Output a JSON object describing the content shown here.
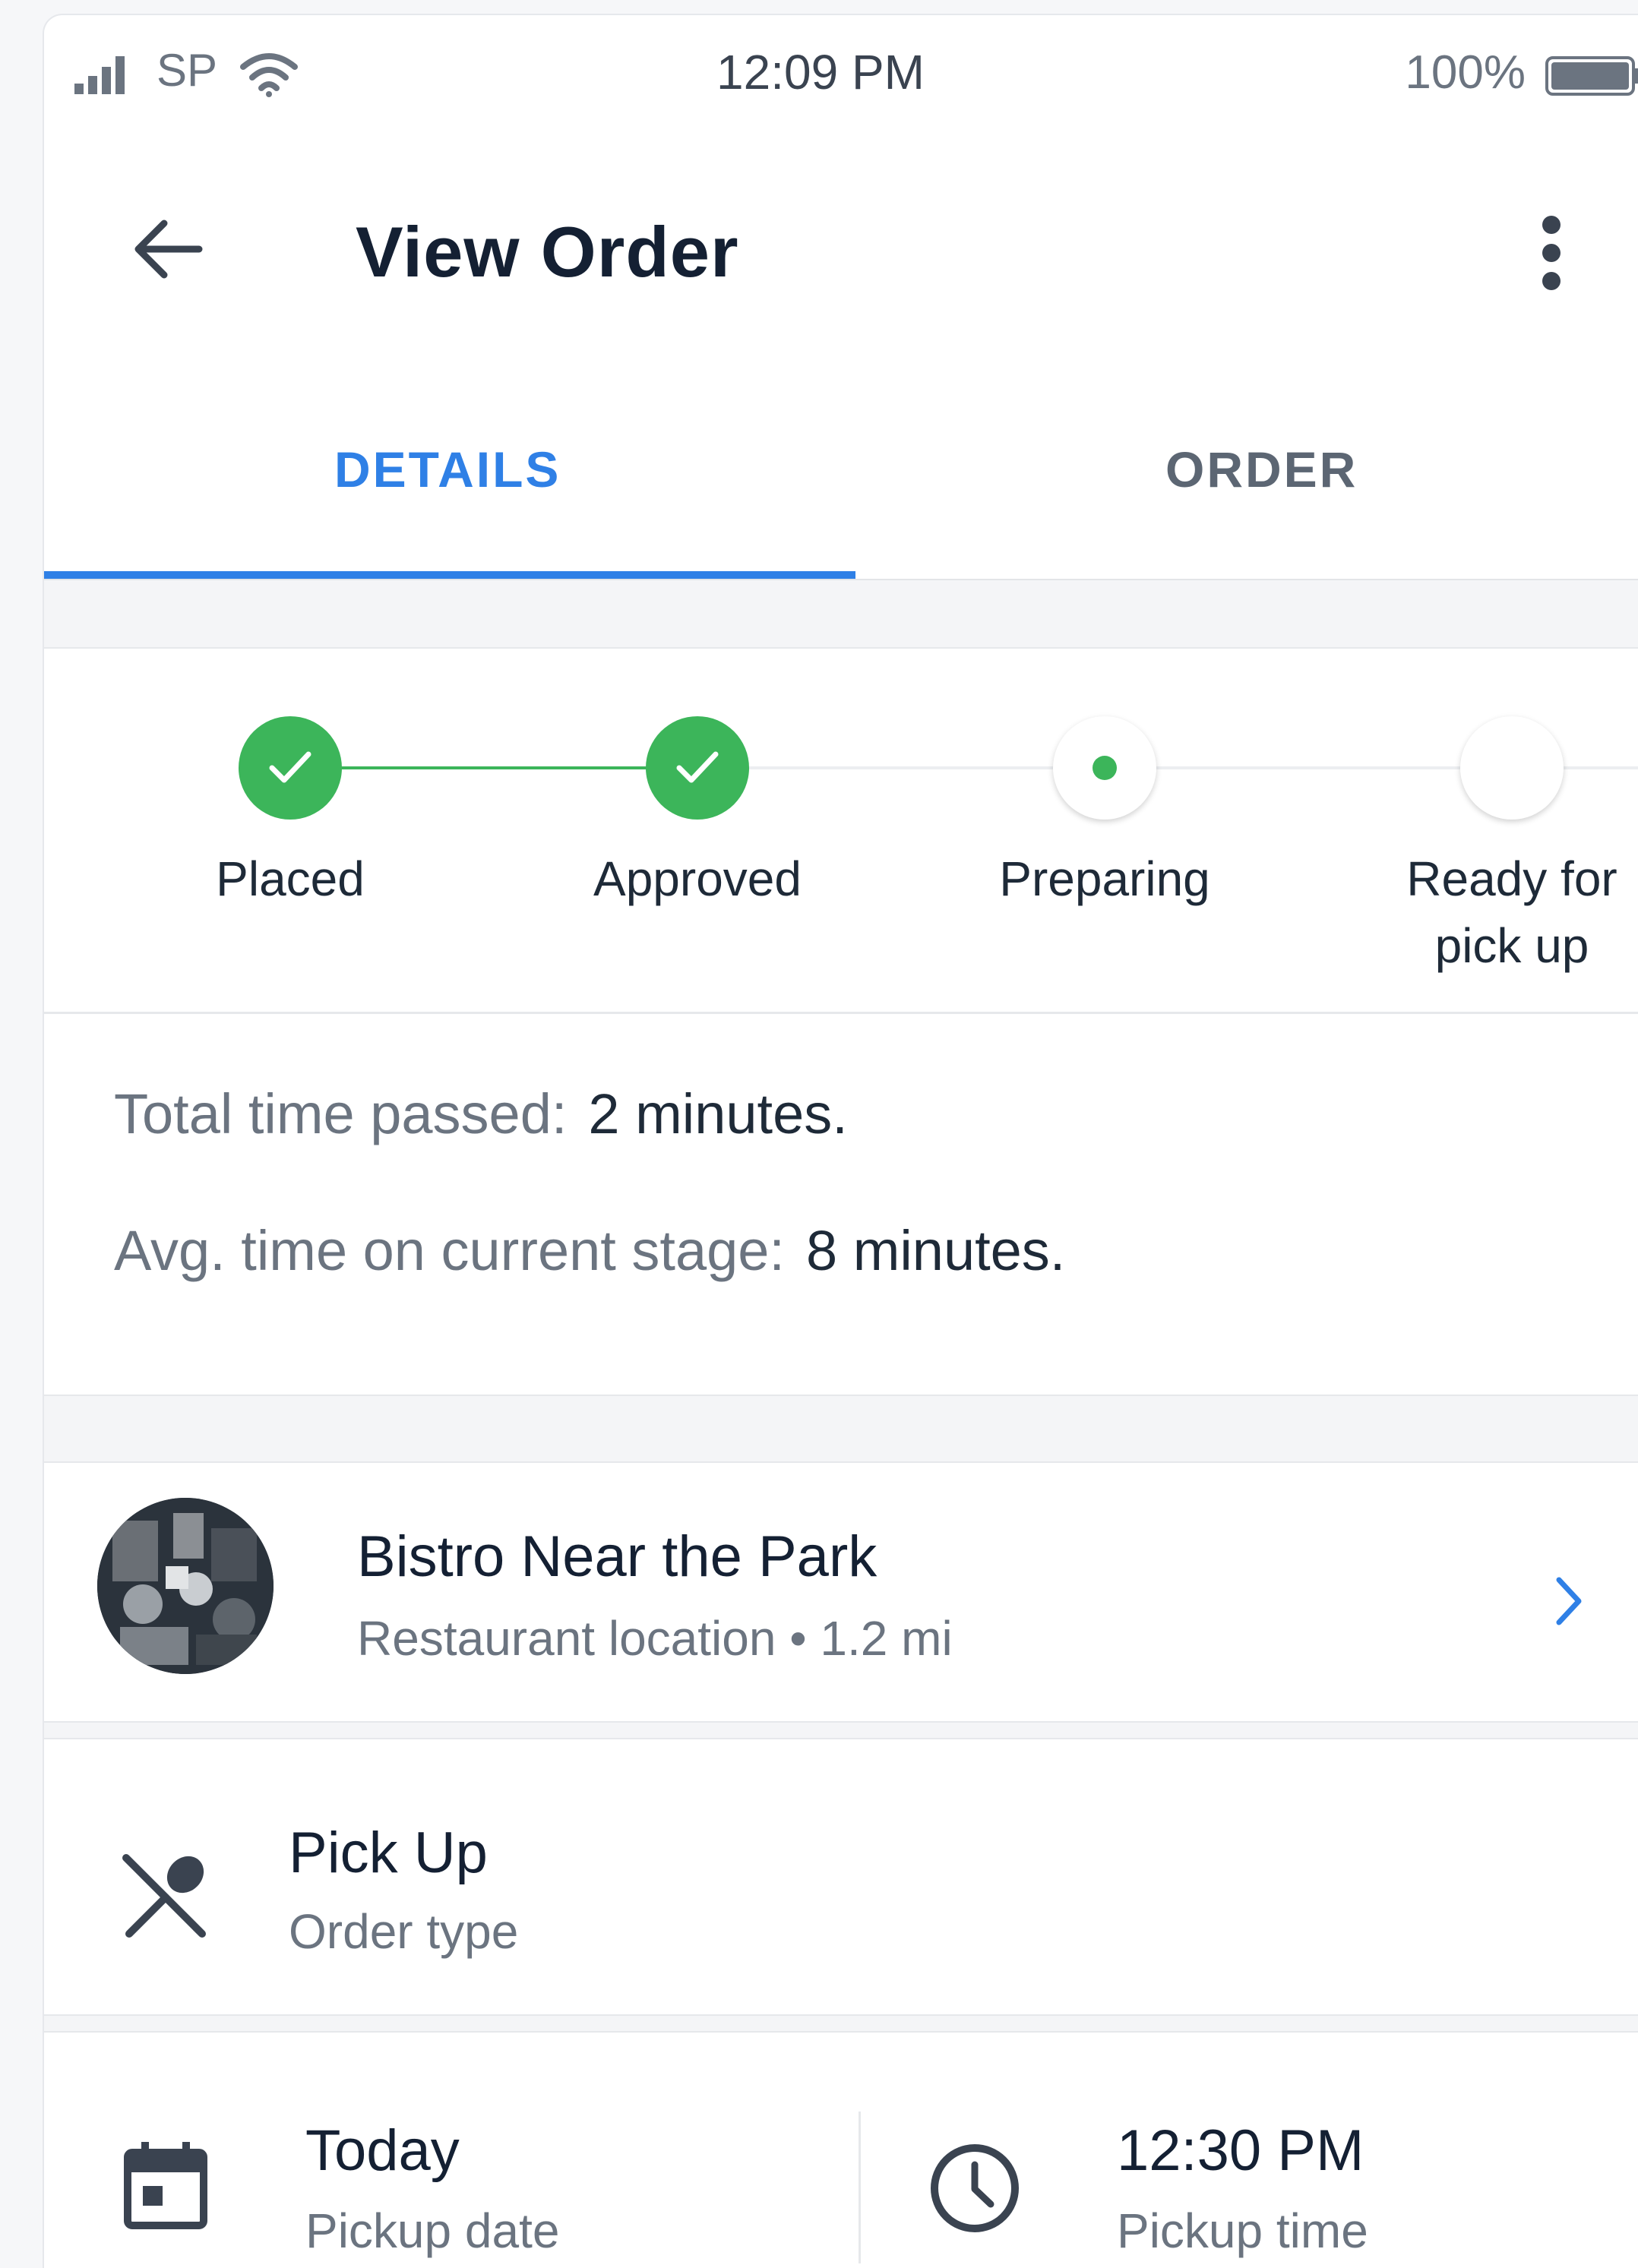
{
  "status_bar": {
    "carrier": "SP",
    "time": "12:09 PM",
    "battery": "100%"
  },
  "header": {
    "title": "View Order"
  },
  "tabs": [
    {
      "label": "DETAILS",
      "active": true
    },
    {
      "label": "ORDER",
      "active": false
    }
  ],
  "progress": {
    "steps": [
      {
        "label": "Placed",
        "state": "done"
      },
      {
        "label": "Approved",
        "state": "done"
      },
      {
        "label": "Preparing",
        "state": "current"
      },
      {
        "label_line1": "Ready for",
        "label_line2": "pick up",
        "state": "pending"
      }
    ]
  },
  "times": {
    "total_label": "Total time passed:",
    "total_value": "2 minutes.",
    "avg_label": "Avg. time on current stage:",
    "avg_value": "8 minutes."
  },
  "restaurant": {
    "name": "Bistro Near the Park",
    "subtitle": "Restaurant location • 1.2 mi"
  },
  "order_type": {
    "value": "Pick Up",
    "label": "Order type"
  },
  "pickup": {
    "date_value": "Today",
    "date_label": "Pickup date",
    "time_value": "12:30 PM",
    "time_label": "Pickup time"
  },
  "colors": {
    "accent": "#2f80e6",
    "success": "#3cb55a",
    "text": "#142033",
    "muted": "#6b7480"
  },
  "icons": [
    "signal-icon",
    "wifi-icon",
    "battery-icon",
    "back-arrow-icon",
    "more-vert-icon",
    "check-icon",
    "chevron-right-icon",
    "fork-spoon-icon",
    "calendar-icon",
    "clock-icon"
  ]
}
